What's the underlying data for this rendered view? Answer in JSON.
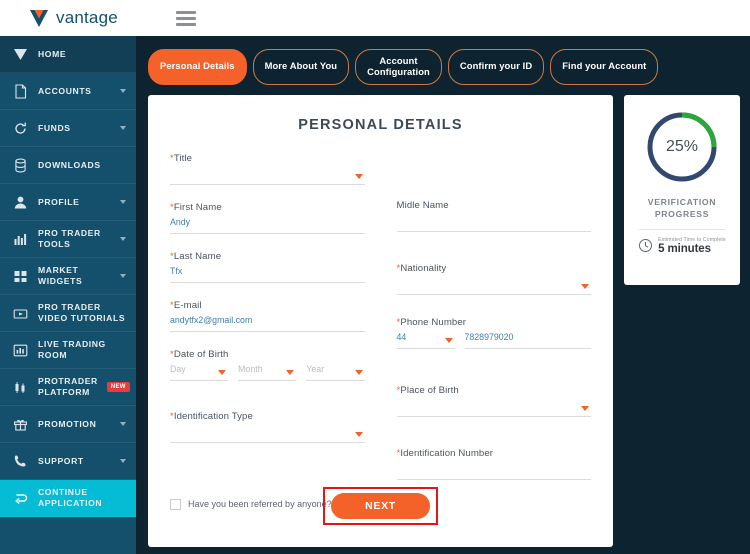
{
  "header": {
    "logo_text": "vantage",
    "menu_icon": "hamburger-icon"
  },
  "sidebar": {
    "items": [
      {
        "label": "HOME",
        "icon": "vantage-v-icon",
        "caret": false,
        "active": true
      },
      {
        "label": "ACCOUNTS",
        "icon": "document-icon",
        "caret": true
      },
      {
        "label": "FUNDS",
        "icon": "refresh-icon",
        "caret": true
      },
      {
        "label": "DOWNLOADS",
        "icon": "database-icon",
        "caret": false
      },
      {
        "label": "PROFILE",
        "icon": "person-icon",
        "caret": true
      },
      {
        "label": "PRO TRADER TOOLS",
        "icon": "chart-bars-icon",
        "caret": true
      },
      {
        "label": "MARKET WIDGETS",
        "icon": "grid-icon",
        "caret": true
      },
      {
        "label": "PRO TRADER VIDEO TUTORIALS",
        "icon": "video-icon",
        "caret": false
      },
      {
        "label": "LIVE TRADING ROOM",
        "icon": "bar-chart-icon",
        "caret": false
      },
      {
        "label": "PROTRADER PLATFORM",
        "icon": "candlestick-icon",
        "caret": false,
        "badge": "NEW"
      },
      {
        "label": "PROMOTION",
        "icon": "gift-icon",
        "caret": true
      },
      {
        "label": "SUPPORT",
        "icon": "phone-icon",
        "caret": true
      },
      {
        "label": "CONTINUE APPLICATION",
        "icon": "arrow-loop-icon",
        "caret": false,
        "highlight": true
      }
    ]
  },
  "steps": [
    {
      "label": "Personal Details",
      "active": true
    },
    {
      "label": "More About You",
      "active": false
    },
    {
      "label": "Account\nConfiguration",
      "active": false
    },
    {
      "label": "Confirm your ID",
      "active": false
    },
    {
      "label": "Find your Account",
      "active": false
    }
  ],
  "form": {
    "title": "PERSONAL DETAILS",
    "left": {
      "title": {
        "label": "Title",
        "required": true,
        "value": "",
        "type": "select"
      },
      "first_name": {
        "label": "First Name",
        "required": true,
        "value": "Andy",
        "type": "text"
      },
      "last_name": {
        "label": "Last Name",
        "required": true,
        "value": "Tfx",
        "type": "text"
      },
      "email": {
        "label": "E-mail",
        "required": true,
        "value": "andytfx2@gmail.com",
        "type": "text"
      },
      "dob": {
        "label": "Date of Birth",
        "required": true,
        "day_placeholder": "Day",
        "month_placeholder": "Month",
        "year_placeholder": "Year"
      },
      "id_type": {
        "label": "Identification Type",
        "required": true,
        "value": "",
        "type": "select"
      }
    },
    "right": {
      "middle_name": {
        "label": "Midle Name",
        "required": false,
        "value": "",
        "type": "text"
      },
      "nationality": {
        "label": "Nationality",
        "required": true,
        "value": "",
        "type": "select"
      },
      "phone": {
        "label": "Phone Number",
        "required": true,
        "country_code": "44",
        "number": "7828979020"
      },
      "place_of_birth": {
        "label": "Place of Birth",
        "required": true,
        "value": "",
        "type": "select"
      },
      "id_number": {
        "label": "Identification Number",
        "required": true,
        "value": "",
        "type": "text"
      }
    },
    "referral_checkbox": {
      "label": "Have you been referred by anyone? (optional)",
      "checked": false
    },
    "next_button": "NEXT"
  },
  "progress": {
    "percent_label": "25%",
    "percent_value": 25,
    "title": "VERIFICATION\nPROGRESS",
    "eta_label": "Estimated Time to Complete",
    "eta_value": "5 minutes",
    "arc_color": "#2aa83a",
    "track_color": "#33486e"
  },
  "colors": {
    "accent_orange": "#f4622a",
    "sidebar": "#14506b",
    "page_bg": "#0d2430",
    "highlight_cyan": "#06bcd4",
    "annotation_red": "#e81313"
  }
}
